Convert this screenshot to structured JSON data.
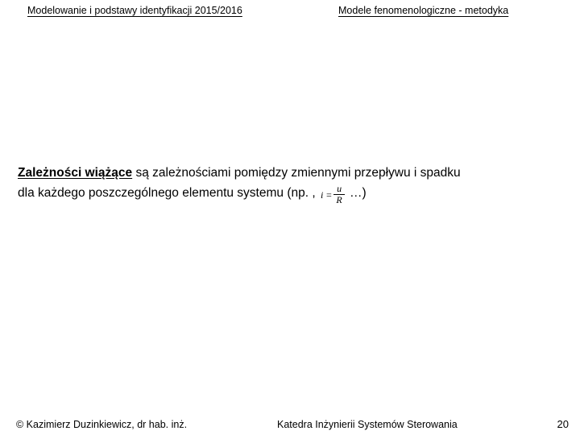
{
  "header": {
    "left": "Modelowanie i podstawy identyfikacji 2015/2016",
    "right": "Modele fenomenologiczne - metodyka"
  },
  "content": {
    "lead_bold": "Zależności wiążące",
    "line1_rest": " są zależnościami pomiędzy zmiennymi przepływu i spadku",
    "line2_pre": "dla każdego poszczególnego elementu systemu (np. , ",
    "formula": {
      "lhs": "i =",
      "num": "u",
      "den": "R"
    },
    "line2_post": "  …)"
  },
  "footer": {
    "left": "© Kazimierz Duzinkiewicz, dr hab. inż.",
    "center": "Katedra Inżynierii Systemów Sterowania",
    "page": "20"
  }
}
